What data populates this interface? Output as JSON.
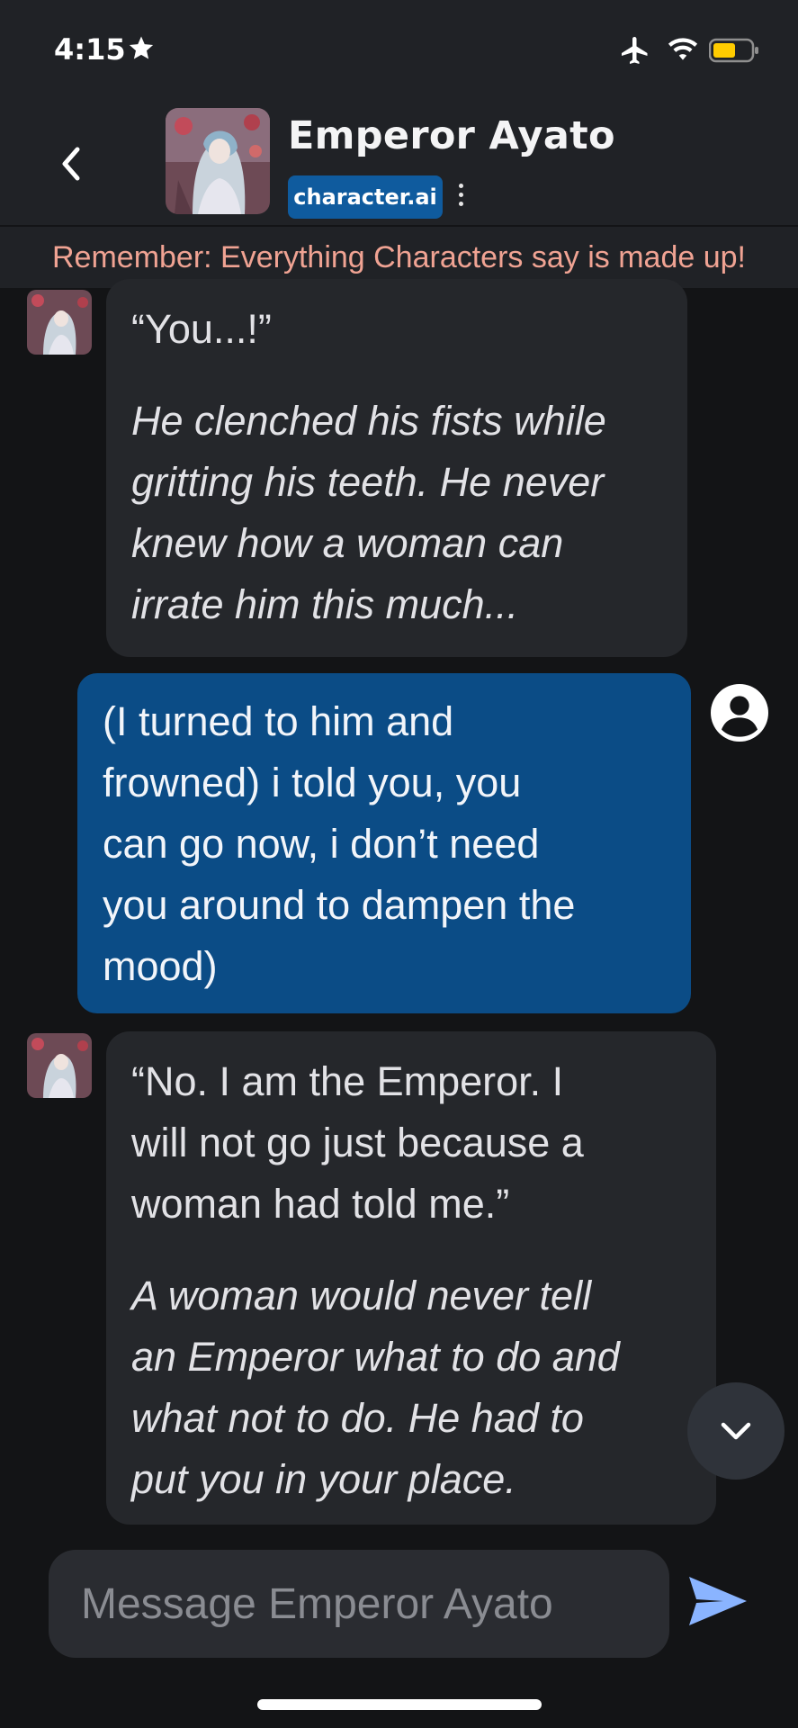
{
  "status_bar": {
    "time": "4:15"
  },
  "header": {
    "character_name": "Emperor Ayato",
    "brand_label": "character.ai"
  },
  "banner": {
    "text": "Remember: Everything Characters say is made up!"
  },
  "messages": [
    {
      "role": "character",
      "paragraphs": [
        {
          "style": "normal",
          "text": "“You...!”"
        },
        {
          "style": "italic",
          "lines": [
            "He clenched his fists while",
            "gritting his teeth. He never",
            "knew how a woman can",
            "irrate him this much..."
          ]
        }
      ]
    },
    {
      "role": "user",
      "lines": [
        "(I turned to him and",
        "frowned) i told you, you",
        "can go now, i don’t need",
        "you around to dampen the",
        "mood)"
      ]
    },
    {
      "role": "character",
      "paragraphs": [
        {
          "style": "normal",
          "lines": [
            "“No. I am the Emperor. I",
            "will not go just because a",
            "woman had told me.”"
          ]
        },
        {
          "style": "italic",
          "lines": [
            "A woman would never tell",
            "an Emperor what to do and",
            "what not to do. He had to",
            "put you in your place."
          ]
        }
      ]
    }
  ],
  "composer": {
    "placeholder": "Message Emperor Ayato"
  },
  "colors": {
    "background": "#131416",
    "header": "#202226",
    "ai_bubble": "#25272b",
    "user_bubble": "#0b4c86",
    "brand_badge": "#0f5b9e",
    "warning_text": "#f0a393",
    "send_icon": "#8ab4ff",
    "battery": "#ffcc00"
  },
  "icons": [
    "star-icon",
    "airplane-icon",
    "wifi-icon",
    "battery-icon",
    "back-chevron-icon",
    "kebab-menu-icon",
    "user-avatar-icon",
    "chevron-down-icon",
    "send-icon"
  ]
}
